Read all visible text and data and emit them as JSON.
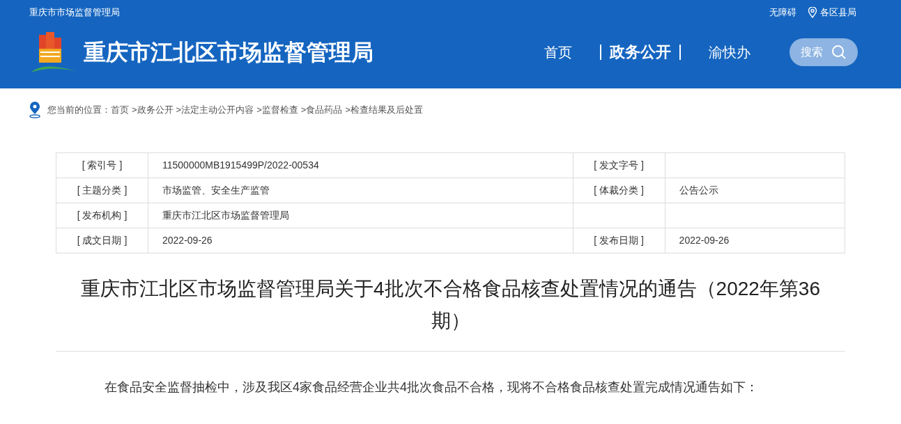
{
  "top_bar": {
    "parent_site": "重庆市市场监督管理局",
    "links": [
      {
        "label": "无障碍",
        "kind": "text"
      },
      {
        "label": "各区县局",
        "kind": "location"
      }
    ]
  },
  "header": {
    "site_title": "重庆市江北区市场监督管理局",
    "nav": [
      {
        "label": "首页",
        "selected": false
      },
      {
        "label": "政务公开",
        "selected": true
      },
      {
        "label": "渝快办",
        "selected": false
      }
    ],
    "search_button": "搜索"
  },
  "breadcrumb": {
    "label": "您当前的位置：",
    "items": [
      "首页",
      ">政务公开",
      ">法定主动公开内容",
      ">监督检查",
      ">食品药品",
      ">检查结果及后处置"
    ]
  },
  "info_table": {
    "rows": [
      [
        "[ 索引号 ]",
        "11500000MB1915499P/2022-00534",
        "[ 发文字号 ]",
        ""
      ],
      [
        "[ 主题分类 ]",
        "市场监管、安全生产监管",
        "[ 体裁分类 ]",
        "公告公示"
      ],
      [
        "[ 发布机构 ]",
        "重庆市江北区市场监督管理局",
        "",
        ""
      ],
      [
        "[ 成文日期 ]",
        "2022-09-26",
        "[ 发布日期 ]",
        "2022-09-26"
      ]
    ]
  },
  "article": {
    "title": "重庆市江北区市场监督管理局关于4批次不合格食品核查处置情况的通告（2022年第36期）",
    "body": "在食品安全监督抽检中，涉及我区4家食品经营企业共4批次食品不合格，现将不合格食品核查处置完成情况通告如下："
  }
}
